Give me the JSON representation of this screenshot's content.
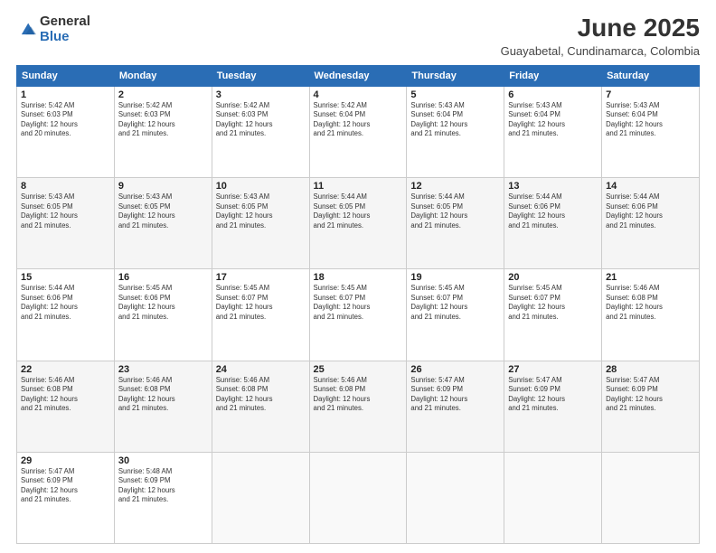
{
  "logo": {
    "general": "General",
    "blue": "Blue"
  },
  "header": {
    "month": "June 2025",
    "location": "Guayabetal, Cundinamarca, Colombia"
  },
  "weekdays": [
    "Sunday",
    "Monday",
    "Tuesday",
    "Wednesday",
    "Thursday",
    "Friday",
    "Saturday"
  ],
  "weeks": [
    [
      {
        "day": "1",
        "sunrise": "5:42 AM",
        "sunset": "6:03 PM",
        "daylight": "12 hours and 20 minutes."
      },
      {
        "day": "2",
        "sunrise": "5:42 AM",
        "sunset": "6:03 PM",
        "daylight": "12 hours and 21 minutes."
      },
      {
        "day": "3",
        "sunrise": "5:42 AM",
        "sunset": "6:03 PM",
        "daylight": "12 hours and 21 minutes."
      },
      {
        "day": "4",
        "sunrise": "5:42 AM",
        "sunset": "6:04 PM",
        "daylight": "12 hours and 21 minutes."
      },
      {
        "day": "5",
        "sunrise": "5:43 AM",
        "sunset": "6:04 PM",
        "daylight": "12 hours and 21 minutes."
      },
      {
        "day": "6",
        "sunrise": "5:43 AM",
        "sunset": "6:04 PM",
        "daylight": "12 hours and 21 minutes."
      },
      {
        "day": "7",
        "sunrise": "5:43 AM",
        "sunset": "6:04 PM",
        "daylight": "12 hours and 21 minutes."
      }
    ],
    [
      {
        "day": "8",
        "sunrise": "5:43 AM",
        "sunset": "6:05 PM",
        "daylight": "12 hours and 21 minutes."
      },
      {
        "day": "9",
        "sunrise": "5:43 AM",
        "sunset": "6:05 PM",
        "daylight": "12 hours and 21 minutes."
      },
      {
        "day": "10",
        "sunrise": "5:43 AM",
        "sunset": "6:05 PM",
        "daylight": "12 hours and 21 minutes."
      },
      {
        "day": "11",
        "sunrise": "5:44 AM",
        "sunset": "6:05 PM",
        "daylight": "12 hours and 21 minutes."
      },
      {
        "day": "12",
        "sunrise": "5:44 AM",
        "sunset": "6:05 PM",
        "daylight": "12 hours and 21 minutes."
      },
      {
        "day": "13",
        "sunrise": "5:44 AM",
        "sunset": "6:06 PM",
        "daylight": "12 hours and 21 minutes."
      },
      {
        "day": "14",
        "sunrise": "5:44 AM",
        "sunset": "6:06 PM",
        "daylight": "12 hours and 21 minutes."
      }
    ],
    [
      {
        "day": "15",
        "sunrise": "5:44 AM",
        "sunset": "6:06 PM",
        "daylight": "12 hours and 21 minutes."
      },
      {
        "day": "16",
        "sunrise": "5:45 AM",
        "sunset": "6:06 PM",
        "daylight": "12 hours and 21 minutes."
      },
      {
        "day": "17",
        "sunrise": "5:45 AM",
        "sunset": "6:07 PM",
        "daylight": "12 hours and 21 minutes."
      },
      {
        "day": "18",
        "sunrise": "5:45 AM",
        "sunset": "6:07 PM",
        "daylight": "12 hours and 21 minutes."
      },
      {
        "day": "19",
        "sunrise": "5:45 AM",
        "sunset": "6:07 PM",
        "daylight": "12 hours and 21 minutes."
      },
      {
        "day": "20",
        "sunrise": "5:45 AM",
        "sunset": "6:07 PM",
        "daylight": "12 hours and 21 minutes."
      },
      {
        "day": "21",
        "sunrise": "5:46 AM",
        "sunset": "6:08 PM",
        "daylight": "12 hours and 21 minutes."
      }
    ],
    [
      {
        "day": "22",
        "sunrise": "5:46 AM",
        "sunset": "6:08 PM",
        "daylight": "12 hours and 21 minutes."
      },
      {
        "day": "23",
        "sunrise": "5:46 AM",
        "sunset": "6:08 PM",
        "daylight": "12 hours and 21 minutes."
      },
      {
        "day": "24",
        "sunrise": "5:46 AM",
        "sunset": "6:08 PM",
        "daylight": "12 hours and 21 minutes."
      },
      {
        "day": "25",
        "sunrise": "5:46 AM",
        "sunset": "6:08 PM",
        "daylight": "12 hours and 21 minutes."
      },
      {
        "day": "26",
        "sunrise": "5:47 AM",
        "sunset": "6:09 PM",
        "daylight": "12 hours and 21 minutes."
      },
      {
        "day": "27",
        "sunrise": "5:47 AM",
        "sunset": "6:09 PM",
        "daylight": "12 hours and 21 minutes."
      },
      {
        "day": "28",
        "sunrise": "5:47 AM",
        "sunset": "6:09 PM",
        "daylight": "12 hours and 21 minutes."
      }
    ],
    [
      {
        "day": "29",
        "sunrise": "5:47 AM",
        "sunset": "6:09 PM",
        "daylight": "12 hours and 21 minutes."
      },
      {
        "day": "30",
        "sunrise": "5:48 AM",
        "sunset": "6:09 PM",
        "daylight": "12 hours and 21 minutes."
      },
      null,
      null,
      null,
      null,
      null
    ]
  ],
  "labels": {
    "sunrise": "Sunrise:",
    "sunset": "Sunset:",
    "daylight": "Daylight: 12 hours"
  }
}
